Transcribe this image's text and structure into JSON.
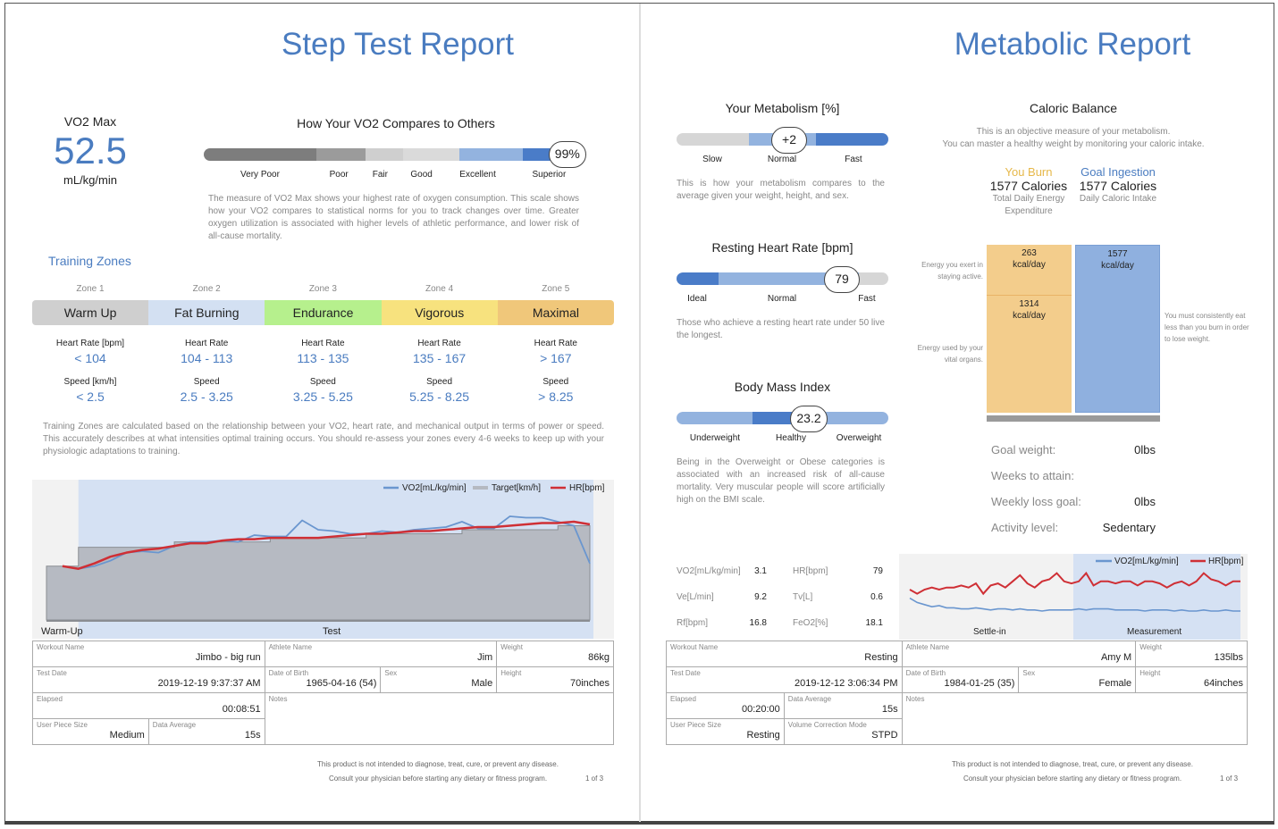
{
  "left": {
    "title": "Step Test Report",
    "vo2max": {
      "label": "VO2 Max",
      "value": "52.5",
      "unit": "mL/kg/min"
    },
    "compare": {
      "heading": "How Your VO2 Compares to Others",
      "categories": [
        "Very Poor",
        "Poor",
        "Fair",
        "Good",
        "Excellent",
        "Superior"
      ],
      "percentile": "99%",
      "percentile_value": 0.99,
      "colors": [
        "#7d7d7d",
        "#9b9b9b",
        "#cfcfcf",
        "#dadada",
        "#93b3df",
        "#4a7cc8"
      ],
      "description": "The measure of VO2 Max shows your highest rate of oxygen consumption. This scale shows how your VO2 compares to statistical norms for you to track changes over time. Greater oxygen utilization is associated with higher levels of athletic performance, and lower risk of all-cause mortality."
    },
    "training_zones": {
      "heading": "Training Zones",
      "zones": [
        {
          "zone": "Zone 1",
          "name": "Warm Up",
          "color": "#cfcfcf",
          "hr_label": "Heart Rate [bpm]",
          "hr": "< 104",
          "speed_label": "Speed [km/h]",
          "speed": "< 2.5"
        },
        {
          "zone": "Zone 2",
          "name": "Fat Burning",
          "color": "#d3e0f2",
          "hr_label": "Heart Rate",
          "hr": "104 - 113",
          "speed_label": "Speed",
          "speed": "2.5 - 3.25"
        },
        {
          "zone": "Zone 3",
          "name": "Endurance",
          "color": "#b6f08d",
          "hr_label": "Heart Rate",
          "hr": "113 - 135",
          "speed_label": "Speed",
          "speed": "3.25 - 5.25"
        },
        {
          "zone": "Zone 4",
          "name": "Vigorous",
          "color": "#f7e27e",
          "hr_label": "Heart Rate",
          "hr": "135 - 167",
          "speed_label": "Speed",
          "speed": "5.25 - 8.25"
        },
        {
          "zone": "Zone 5",
          "name": "Maximal",
          "color": "#f0c77a",
          "hr_label": "Heart Rate",
          "hr": "> 167",
          "speed_label": "Speed",
          "speed": "> 8.25"
        }
      ],
      "description": "Training Zones are calculated based on the relationship between your VO2, heart rate, and mechanical output in terms of power or speed. This accurately describes at what intensities optimal training occurs. You should re-assess your zones every 4-6 weeks to keep up with your physiologic adaptations to training."
    },
    "info": {
      "workout_name": {
        "label": "Workout Name",
        "value": "Jimbo - big run"
      },
      "athlete_name": {
        "label": "Athlete Name",
        "value": "Jim"
      },
      "weight": {
        "label": "Weight",
        "value": "86kg"
      },
      "test_date": {
        "label": "Test Date",
        "value": "2019-12-19 9:37:37 AM"
      },
      "dob": {
        "label": "Date of Birth",
        "value": "1965-04-16 (54)"
      },
      "sex": {
        "label": "Sex",
        "value": "Male"
      },
      "height": {
        "label": "Height",
        "value": "70inches"
      },
      "elapsed": {
        "label": "Elapsed",
        "value": "00:08:51"
      },
      "notes": {
        "label": "Notes",
        "value": ""
      },
      "piece_size": {
        "label": "User Piece Size",
        "value": "Medium"
      },
      "data_average": {
        "label": "Data Average",
        "value": "15s"
      }
    },
    "footer": {
      "line1": "This product is not intended to diagnose, treat, cure, or prevent any disease.",
      "line2": "Consult your physician before starting any dietary or fitness program.",
      "page": "1 of 3"
    }
  },
  "right": {
    "title": "Metabolic Report",
    "metabolism": {
      "heading": "Your Metabolism [%]",
      "value": "+2",
      "position": 0.52,
      "labels": [
        "Slow",
        "Normal",
        "Fast"
      ],
      "description": "This is how your metabolism compares to the average given your weight, height, and sex."
    },
    "resting_hr": {
      "heading": "Resting Heart Rate [bpm]",
      "value": "79",
      "position": 0.78,
      "labels": [
        "Ideal",
        "Normal",
        "Fast"
      ],
      "description": "Those who achieve a resting heart rate under 50 live the longest."
    },
    "bmi": {
      "heading": "Body Mass Index",
      "value": "23.2",
      "position": 0.62,
      "labels": [
        "Underweight",
        "Healthy",
        "Overweight"
      ],
      "description": "Being in the Overweight or Obese categories is associated with an increased risk of all-cause mortality. Very muscular people will score artificially high on the BMI scale."
    },
    "caloric": {
      "heading": "Caloric Balance",
      "sub1": "This is an objective measure of your metabolism.",
      "sub2": "You can master a healthy weight by monitoring your caloric intake.",
      "burn_label": "You Burn",
      "burn_value": "1577 Calories",
      "burn_desc": "Total Daily Energy Expenditure",
      "goal_label": "Goal Ingestion",
      "goal_value": "1577 Calories",
      "goal_desc": "Daily Caloric Intake",
      "active_note": "Energy you exert in staying active.",
      "organs_note": "Energy used by your vital organs.",
      "right_note": "You must consistently eat less than you burn in order to lose weight.",
      "active_kcal": 263,
      "organs_kcal": 1314,
      "intake_kcal": 1577,
      "active_text": "263",
      "organs_text": "1314",
      "intake_text": "1577",
      "unit": "kcal/day"
    },
    "goals": [
      {
        "label": "Goal weight:",
        "value": "0lbs"
      },
      {
        "label": "Weeks to attain:",
        "value": ""
      },
      {
        "label": "Weekly loss goal:",
        "value": "0lbs"
      },
      {
        "label": "Activity level:",
        "value": "Sedentary"
      }
    ],
    "stats": [
      {
        "label": "VO2[mL/kg/min]",
        "value": "3.1",
        "label2": "HR[bpm]",
        "value2": "79"
      },
      {
        "label": "Ve[L/min]",
        "value": "9.2",
        "label2": "Tv[L]",
        "value2": "0.6"
      },
      {
        "label": "Rf[bpm]",
        "value": "16.8",
        "label2": "FeO2[%]",
        "value2": "18.1"
      }
    ],
    "info": {
      "workout_name": {
        "label": "Workout Name",
        "value": "Resting"
      },
      "athlete_name": {
        "label": "Athlete Name",
        "value": "Amy M"
      },
      "weight": {
        "label": "Weight",
        "value": "135lbs"
      },
      "test_date": {
        "label": "Test Date",
        "value": "2019-12-12 3:06:34 PM"
      },
      "dob": {
        "label": "Date of Birth",
        "value": "1984-01-25 (35)"
      },
      "sex": {
        "label": "Sex",
        "value": "Female"
      },
      "height": {
        "label": "Height",
        "value": "64inches"
      },
      "elapsed": {
        "label": "Elapsed",
        "value": "00:20:00"
      },
      "data_average": {
        "label": "Data Average",
        "value": "15s"
      },
      "notes": {
        "label": "Notes",
        "value": ""
      },
      "piece_size": {
        "label": "User Piece Size",
        "value": "Resting"
      },
      "volume_mode": {
        "label": "Volume Correction Mode",
        "value": "STPD"
      }
    },
    "footer": {
      "line1": "This product is not intended to diagnose, treat, cure, or prevent any disease.",
      "line2": "Consult your physician before starting any dietary or fitness program.",
      "page": "1 of 3"
    }
  },
  "chart_data": [
    {
      "type": "line",
      "title": "",
      "legend": [
        "VO2[mL/kg/min]",
        "Target[km/h]",
        "HR[bpm]"
      ],
      "legend_position": "top-right",
      "phases": [
        "Warm-Up",
        "Test"
      ],
      "colors": {
        "vo2": "#6a96cf",
        "target": "#b5b9c1",
        "hr": "#cf2f35"
      },
      "x": [
        0,
        1,
        2,
        3,
        4,
        5,
        6,
        7,
        8,
        9,
        10,
        11,
        12,
        13,
        14,
        15,
        16,
        17,
        18,
        19,
        20,
        21,
        22,
        23,
        24,
        25,
        26,
        27,
        28,
        29,
        30,
        31,
        32,
        33,
        34
      ],
      "phase_split_x": 2,
      "target_steps": [
        [
          0,
          40
        ],
        [
          2,
          40
        ],
        [
          2,
          54
        ],
        [
          8,
          54
        ],
        [
          8,
          58
        ],
        [
          14,
          58
        ],
        [
          14,
          61
        ],
        [
          20,
          61
        ],
        [
          20,
          64
        ],
        [
          26,
          64
        ],
        [
          26,
          67
        ],
        [
          32,
          67
        ],
        [
          32,
          70
        ],
        [
          34,
          70
        ]
      ],
      "series": [
        {
          "name": "VO2[mL/kg/min]",
          "values": [
            null,
            null,
            38,
            40,
            44,
            50,
            51,
            50,
            55,
            58,
            58,
            59,
            58,
            63,
            62,
            62,
            74,
            67,
            66,
            64,
            64,
            66,
            65,
            67,
            68,
            69,
            73,
            68,
            68,
            77,
            76,
            76,
            73,
            70,
            42
          ]
        },
        {
          "name": "HR[bpm]",
          "values": [
            null,
            40,
            38,
            42,
            47,
            50,
            52,
            53,
            55,
            57,
            57,
            59,
            60,
            60,
            61,
            61,
            61,
            61,
            62,
            63,
            64,
            64,
            65,
            66,
            66,
            67,
            68,
            69,
            69,
            70,
            71,
            72,
            72,
            73,
            71
          ]
        }
      ],
      "ylim": [
        0,
        100
      ]
    },
    {
      "type": "line",
      "title": "",
      "legend": [
        "VO2[mL/kg/min]",
        "HR[bpm]"
      ],
      "legend_position": "top-right",
      "phases": [
        "Settle-in",
        "Measurement"
      ],
      "phase_split_fraction": 0.5,
      "colors": {
        "vo2": "#6a96cf",
        "hr": "#cf2f35"
      },
      "series": [
        {
          "name": "VO2[mL/kg/min]",
          "values": [
            4.6,
            4.2,
            4.0,
            3.8,
            3.9,
            3.7,
            3.7,
            3.6,
            3.6,
            3.7,
            3.6,
            3.5,
            3.6,
            3.6,
            3.5,
            3.6,
            3.5,
            3.5,
            3.4,
            3.5,
            3.5,
            3.5,
            3.5,
            3.6,
            3.5,
            3.6,
            3.6,
            3.6,
            3.5,
            3.5,
            3.5,
            3.5,
            3.4,
            3.5,
            3.5,
            3.5,
            3.4,
            3.5,
            3.4,
            3.4,
            3.5,
            3.4,
            3.4,
            3.5,
            3.4,
            3.4
          ]
        },
        {
          "name": "HR[bpm]",
          "values": [
            76,
            74,
            76,
            77,
            76,
            77,
            77,
            78,
            77,
            79,
            74,
            78,
            79,
            77,
            80,
            83,
            79,
            77,
            80,
            81,
            84,
            80,
            79,
            80,
            84,
            78,
            80,
            80,
            79,
            80,
            80,
            78,
            80,
            80,
            79,
            77,
            79,
            80,
            78,
            80,
            84,
            81,
            80,
            78,
            80,
            80
          ]
        }
      ]
    }
  ]
}
